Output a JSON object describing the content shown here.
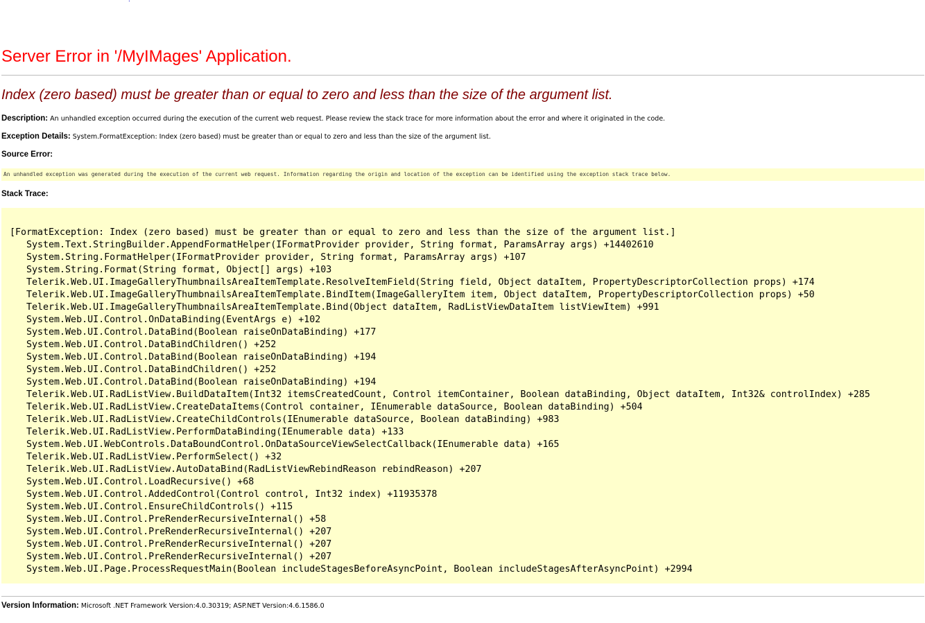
{
  "header": {
    "dot_link": ".",
    "title": "Server Error in '/MyIMages' Application.",
    "message": "Index (zero based) must be greater than or equal to zero and less than the size of the argument list."
  },
  "description": {
    "label": "Description:",
    "text": "An unhandled exception occurred during the execution of the current web request. Please review the stack trace for more information about the error and where it originated in the code."
  },
  "exception_details": {
    "label": "Exception Details:",
    "text": "System.FormatException: Index (zero based) must be greater than or equal to zero and less than the size of the argument list."
  },
  "source_error": {
    "label": "Source Error:",
    "text": "An unhandled exception was generated during the execution of the current web request. Information regarding the origin and location of the exception can be identified using the exception stack trace below."
  },
  "stack_trace": {
    "label": "Stack Trace:",
    "lines": [
      "[FormatException: Index (zero based) must be greater than or equal to zero and less than the size of the argument list.]",
      "   System.Text.StringBuilder.AppendFormatHelper(IFormatProvider provider, String format, ParamsArray args) +14402610",
      "   System.String.FormatHelper(IFormatProvider provider, String format, ParamsArray args) +107",
      "   System.String.Format(String format, Object[] args) +103",
      "   Telerik.Web.UI.ImageGalleryThumbnailsAreaItemTemplate.ResolveItemField(String field, Object dataItem, PropertyDescriptorCollection props) +174",
      "   Telerik.Web.UI.ImageGalleryThumbnailsAreaItemTemplate.BindItem(ImageGalleryItem item, Object dataItem, PropertyDescriptorCollection props) +50",
      "   Telerik.Web.UI.ImageGalleryThumbnailsAreaItemTemplate.Bind(Object dataItem, RadListViewDataItem listViewItem) +991",
      "   System.Web.UI.Control.OnDataBinding(EventArgs e) +102",
      "   System.Web.UI.Control.DataBind(Boolean raiseOnDataBinding) +177",
      "   System.Web.UI.Control.DataBindChildren() +252",
      "   System.Web.UI.Control.DataBind(Boolean raiseOnDataBinding) +194",
      "   System.Web.UI.Control.DataBindChildren() +252",
      "   System.Web.UI.Control.DataBind(Boolean raiseOnDataBinding) +194",
      "   Telerik.Web.UI.RadListView.BuildDataItem(Int32 itemsCreatedCount, Control itemContainer, Boolean dataBinding, Object dataItem, Int32& controlIndex) +285",
      "   Telerik.Web.UI.RadListView.CreateDataItems(Control container, IEnumerable dataSource, Boolean dataBinding) +504",
      "   Telerik.Web.UI.RadListView.CreateChildControls(IEnumerable dataSource, Boolean dataBinding) +983",
      "   Telerik.Web.UI.RadListView.PerformDataBinding(IEnumerable data) +133",
      "   System.Web.UI.WebControls.DataBoundControl.OnDataSourceViewSelectCallback(IEnumerable data) +165",
      "   Telerik.Web.UI.RadListView.PerformSelect() +32",
      "   Telerik.Web.UI.RadListView.AutoDataBind(RadListViewRebindReason rebindReason) +207",
      "   System.Web.UI.Control.LoadRecursive() +68",
      "   System.Web.UI.Control.AddedControl(Control control, Int32 index) +11935378",
      "   System.Web.UI.Control.EnsureChildControls() +115",
      "   System.Web.UI.Control.PreRenderRecursiveInternal() +58",
      "   System.Web.UI.Control.PreRenderRecursiveInternal() +207",
      "   System.Web.UI.Control.PreRenderRecursiveInternal() +207",
      "   System.Web.UI.Control.PreRenderRecursiveInternal() +207",
      "   System.Web.UI.Page.ProcessRequestMain(Boolean includeStagesBeforeAsyncPoint, Boolean includeStagesAfterAsyncPoint) +2994"
    ]
  },
  "version_info": {
    "label": "Version Information:",
    "text": "Microsoft .NET Framework Version:4.0.30319; ASP.NET Version:4.6.1586.0"
  },
  "colors": {
    "title": "#ff0000",
    "message": "#800000",
    "code_background": "#ffffcc",
    "rule": "#bcbcbc"
  }
}
